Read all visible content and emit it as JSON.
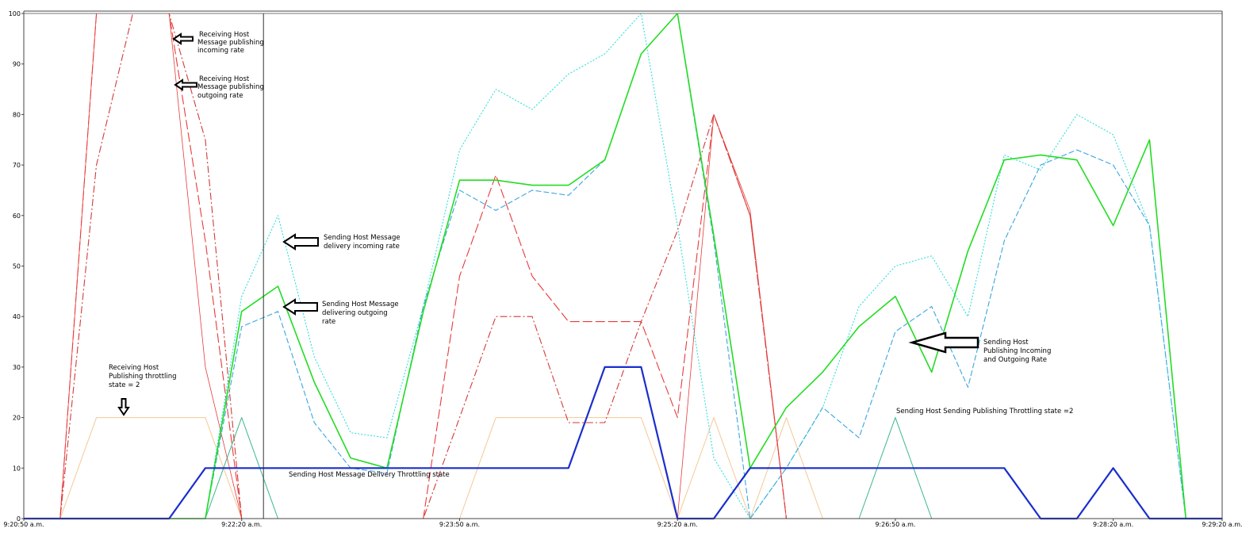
{
  "chart_data": {
    "type": "line",
    "ylim": [
      0,
      100
    ],
    "yticks": [
      0,
      10,
      20,
      30,
      40,
      50,
      60,
      70,
      80,
      90,
      100
    ],
    "x_tick_labels": [
      "9:20:50 a.m.",
      "9:22:20 a.m.",
      "9:23:50 a.m.",
      "9:25:20 a.m.",
      "9:26:50 a.m.",
      "9:28:20 a.m.",
      "9:29:20 a.m."
    ],
    "x_tick_index": [
      0,
      30,
      60,
      90,
      120,
      150,
      165
    ],
    "x_step_index": [
      0,
      5,
      10,
      15,
      20,
      25,
      30,
      35,
      40,
      45,
      50,
      55,
      60,
      65,
      70,
      75,
      80,
      85,
      90,
      95,
      100,
      105,
      110,
      115,
      120,
      125,
      130,
      135,
      140,
      145,
      150,
      155,
      160,
      165
    ],
    "cursor_index": 33,
    "grid": false,
    "legend": "none",
    "series": [
      {
        "color": "#f5c896",
        "dash": "",
        "width": 1,
        "values": [
          0,
          0,
          20,
          20,
          20,
          20,
          0,
          0,
          0,
          0,
          0,
          0,
          0,
          20,
          20,
          20,
          20,
          20,
          0,
          20,
          0,
          20,
          0,
          0,
          0,
          0,
          0,
          0,
          0,
          0,
          0,
          0,
          0,
          0
        ]
      },
      {
        "color": "#3cb88a",
        "dash": "",
        "width": 1,
        "values": [
          0,
          0,
          0,
          0,
          0,
          0,
          20,
          0,
          0,
          0,
          0,
          0,
          0,
          0,
          0,
          0,
          0,
          0,
          0,
          0,
          0,
          0,
          0,
          0,
          20,
          0,
          0,
          0,
          0,
          0,
          0,
          0,
          0,
          0
        ]
      },
      {
        "color": "#33dddd",
        "dash": "2 2",
        "width": 1.1,
        "values": [
          0,
          0,
          0,
          0,
          0,
          0,
          44,
          60,
          32,
          17,
          16,
          42,
          73,
          85,
          81,
          88,
          92,
          100,
          58,
          12,
          0,
          10,
          22,
          42,
          50,
          52,
          40,
          72,
          69,
          80,
          76,
          58,
          0,
          0
        ]
      },
      {
        "color": "#3aa6e0",
        "dash": "7 3",
        "width": 1.1,
        "values": [
          0,
          0,
          0,
          0,
          0,
          0,
          38,
          41,
          19,
          10,
          9,
          42,
          65,
          61,
          65,
          64,
          71,
          92,
          100,
          55,
          0,
          10,
          22,
          16,
          37,
          42,
          26,
          55,
          70,
          73,
          70,
          58,
          0,
          0
        ]
      },
      {
        "color": "#e83a3a",
        "dash": "12 4",
        "width": 1.1,
        "values": [
          0,
          0,
          100,
          100,
          100,
          55,
          0,
          0,
          0,
          0,
          0,
          0,
          48,
          68,
          48,
          39,
          39,
          39,
          20,
          80,
          60,
          0,
          0,
          0,
          0,
          0,
          0,
          0,
          0,
          0,
          0,
          0,
          0,
          0
        ]
      },
      {
        "color": "#d33a3a",
        "dash": "9 3 2 3",
        "width": 1.1,
        "values": [
          0,
          0,
          70,
          100,
          100,
          75,
          0,
          0,
          0,
          0,
          0,
          0,
          20,
          40,
          40,
          19,
          19,
          39,
          57,
          80,
          60,
          0,
          0,
          0,
          0,
          0,
          0,
          0,
          0,
          0,
          0,
          0,
          0,
          0
        ]
      },
      {
        "color": "#e83a3a",
        "dash": "",
        "width": 0.8,
        "values": [
          0,
          0,
          100,
          100,
          100,
          30,
          0,
          0,
          0,
          0,
          0,
          0,
          0,
          0,
          0,
          0,
          0,
          0,
          0,
          80,
          61,
          0,
          0,
          0,
          0,
          0,
          0,
          0,
          0,
          0,
          0,
          0,
          0,
          0
        ]
      },
      {
        "color": "#22dd22",
        "dash": "",
        "width": 1.6,
        "values": [
          0,
          0,
          0,
          0,
          0,
          0,
          41,
          46,
          27,
          12,
          10,
          41,
          67,
          67,
          66,
          66,
          71,
          92,
          100,
          56,
          10,
          22,
          29,
          38,
          44,
          29,
          53,
          71,
          72,
          71,
          58,
          75,
          0,
          0
        ]
      },
      {
        "color": "#1a2ecc",
        "dash": "",
        "width": 2.2,
        "values": [
          0,
          0,
          0,
          0,
          0,
          10,
          10,
          10,
          10,
          10,
          10,
          10,
          10,
          10,
          10,
          10,
          30,
          30,
          0,
          0,
          10,
          10,
          10,
          10,
          10,
          10,
          10,
          10,
          0,
          0,
          10,
          0,
          0,
          0
        ]
      }
    ]
  },
  "annotations": {
    "recv_incoming": [
      "Receiving Host",
      "Message publishing",
      "incoming rate"
    ],
    "recv_outgoing": [
      "Receiving Host",
      "Message publishing",
      "outgoing rate"
    ],
    "send_delivery_in": [
      "Sending Host Message",
      "delivery incoming rate"
    ],
    "send_delivering_out": [
      "Sending Host Message",
      "delivering outgoing",
      "rate"
    ],
    "send_publishing": [
      "Sending Host",
      "Publishing Incoming",
      "and Outgoing Rate"
    ],
    "recv_throttle": [
      "Receiving  Host",
      "Publishing throttling",
      "state = 2"
    ],
    "send_pub_throttle": "Sending Host Sending Publishing Throttling state =2",
    "send_delivery_throttle": "Sending Host Message Delivery Throttling state"
  }
}
